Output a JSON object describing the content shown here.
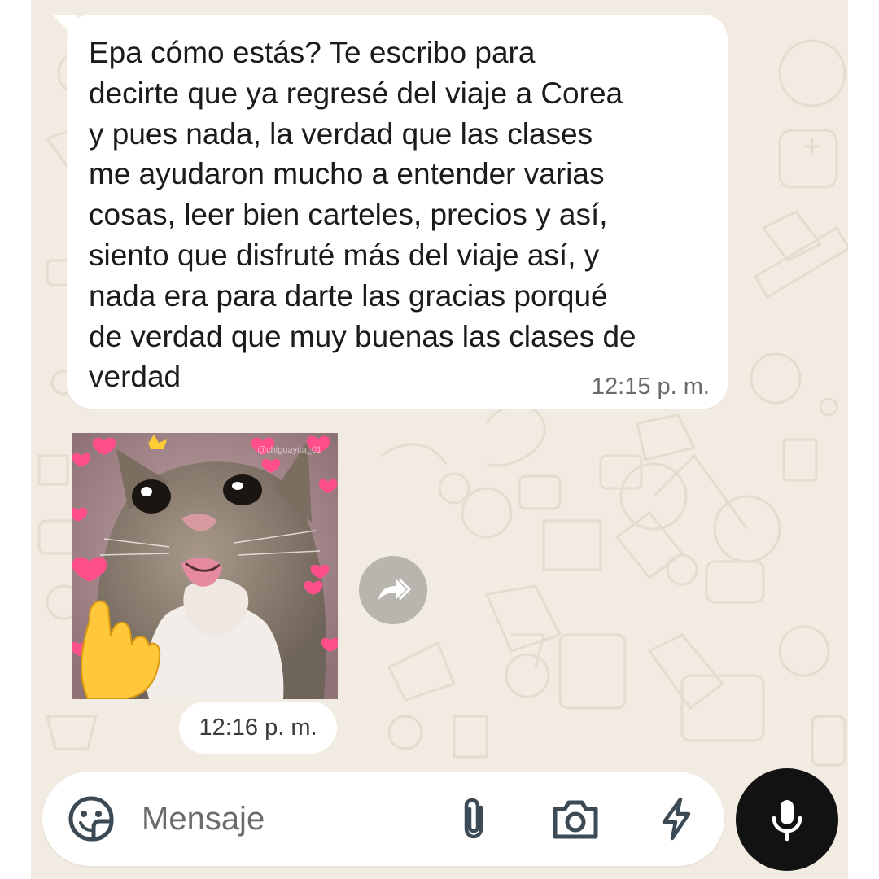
{
  "messages": [
    {
      "type": "text",
      "text": "Epa cómo estás? Te escribo para\ndecirte que ya regresé del viaje a Corea\ny pues nada, la verdad que las clases\nme ayudaron mucho a entender varias\ncosas, leer bien carteles, precios y así,\nsiento que disfruté más del viaje así, y\nnada era para darte las gracias porqué\nde verdad que muy buenas las clases de\nverdad",
      "time": "12:15 p. m."
    },
    {
      "type": "sticker",
      "description_icon": "cat-hearts-sticker",
      "time": "12:16 p. m."
    }
  ],
  "composer": {
    "placeholder": "Mensaje"
  },
  "icons": {
    "emoji": "sticker-emoji-icon",
    "attach": "paperclip-icon",
    "camera": "camera-icon",
    "quick": "lightning-bolt-icon",
    "mic": "microphone-icon",
    "forward": "forward-icon"
  },
  "colors": {
    "chat_background": "#f1ebe1",
    "bubble": "#ffffff",
    "mic_button": "#121212",
    "forward_button": "#b8b4ae"
  }
}
